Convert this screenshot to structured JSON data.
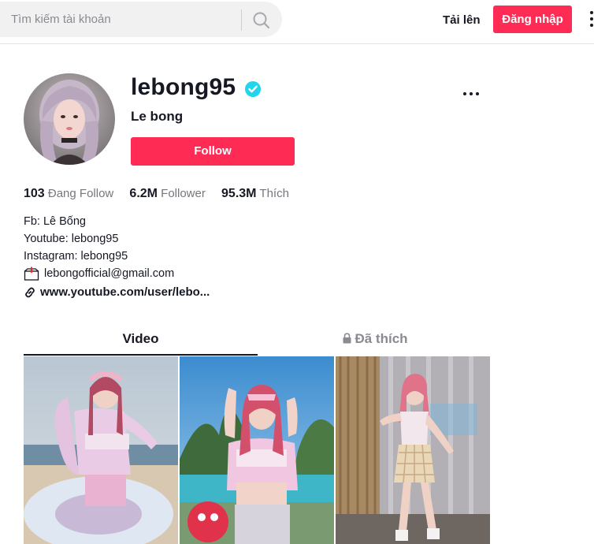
{
  "header": {
    "search_placeholder": "Tìm kiếm tài khoản",
    "upload_label": "Tải lên",
    "login_label": "Đăng nhập"
  },
  "profile": {
    "username": "lebong95",
    "nickname": "Le bong",
    "follow_label": "Follow",
    "stats": [
      {
        "value": "103",
        "label": "Đang Follow"
      },
      {
        "value": "6.2M",
        "label": "Follower"
      },
      {
        "value": "95.3M",
        "label": "Thích"
      }
    ],
    "bio": {
      "line1": "Fb: Lê Bống",
      "line2": "Youtube: lebong95",
      "line3": "Instagram: lebong95",
      "email": "lebongofficial@gmail.com"
    },
    "link": "www.youtube.com/user/lebo..."
  },
  "tabs": {
    "video": "Video",
    "liked": "Đã thích"
  },
  "colors": {
    "accent": "#fe2c55",
    "verified": "#20d5ec"
  }
}
